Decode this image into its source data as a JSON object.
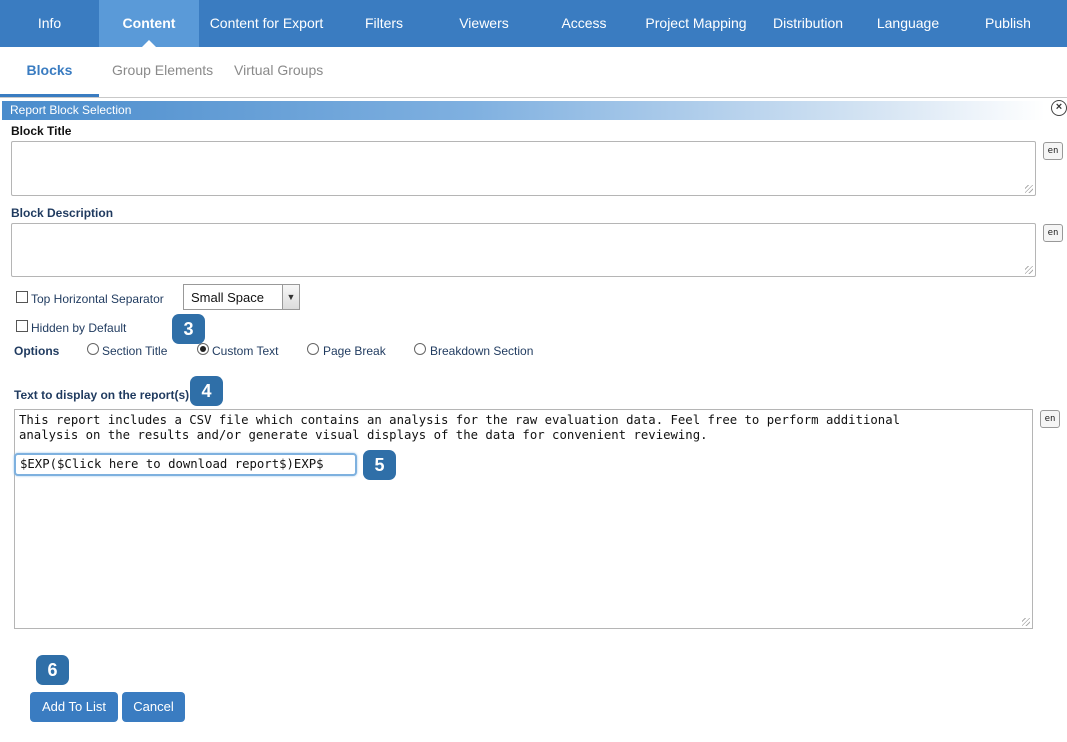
{
  "topnav": {
    "tabs": [
      {
        "label": "Info",
        "active": false
      },
      {
        "label": "Content",
        "active": true
      },
      {
        "label": "Content for Export",
        "active": false
      },
      {
        "label": "Filters",
        "active": false
      },
      {
        "label": "Viewers",
        "active": false
      },
      {
        "label": "Access",
        "active": false
      },
      {
        "label": "Project Mapping",
        "active": false
      },
      {
        "label": "Distribution",
        "active": false
      },
      {
        "label": "Language",
        "active": false
      },
      {
        "label": "Publish",
        "active": false
      }
    ]
  },
  "subtabs": {
    "items": [
      {
        "label": "Blocks",
        "active": true
      },
      {
        "label": "Group Elements",
        "active": false
      },
      {
        "label": "Virtual Groups",
        "active": false
      }
    ]
  },
  "panel": {
    "title": "Report Block Selection",
    "close_icon": "close-circle-icon"
  },
  "form": {
    "block_title_label": "Block Title",
    "block_title_value": "",
    "block_description_label": "Block Description",
    "block_description_value": "",
    "lang_button": "en",
    "top_separator_label": "Top Horizontal Separator",
    "top_separator_checked": false,
    "separator_select_value": "Small Space",
    "hidden_default_label": "Hidden by Default",
    "hidden_default_checked": false,
    "options_label": "Options",
    "options": [
      {
        "label": "Section Title",
        "checked": false
      },
      {
        "label": "Custom Text",
        "checked": true
      },
      {
        "label": "Page Break",
        "checked": false
      },
      {
        "label": "Breakdown Section",
        "checked": false
      }
    ],
    "report_text_label": "Text to display on the report(s)",
    "report_text": "This report includes a CSV file which contains an analysis for the raw evaluation data. Feel free to perform additional\nanalysis on the results and/or generate visual displays of the data for convenient reviewing.",
    "exp_text": "$EXP($Click here to download report$)EXP$"
  },
  "badges": {
    "b3": "3",
    "b4": "4",
    "b5": "5",
    "b6": "6"
  },
  "buttons": {
    "add": "Add To List",
    "cancel": "Cancel"
  },
  "colors": {
    "nav": "#3a7cc1",
    "nav_active": "#5a9ad8",
    "badge": "#2f6fa8",
    "label": "#1f3a5f"
  }
}
